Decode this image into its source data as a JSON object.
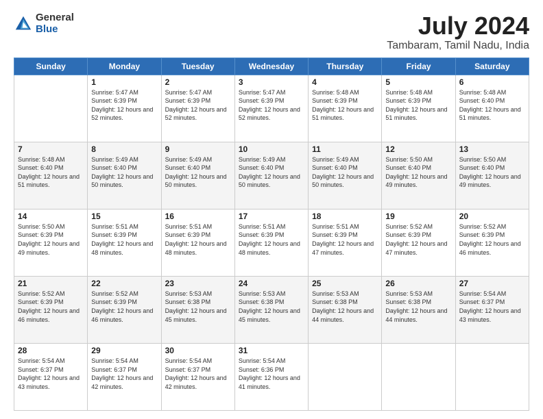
{
  "logo": {
    "general": "General",
    "blue": "Blue"
  },
  "title": "July 2024",
  "subtitle": "Tambaram, Tamil Nadu, India",
  "columns": [
    "Sunday",
    "Monday",
    "Tuesday",
    "Wednesday",
    "Thursday",
    "Friday",
    "Saturday"
  ],
  "weeks": [
    [
      {
        "day": "",
        "sunrise": "",
        "sunset": "",
        "daylight": ""
      },
      {
        "day": "1",
        "sunrise": "Sunrise: 5:47 AM",
        "sunset": "Sunset: 6:39 PM",
        "daylight": "Daylight: 12 hours and 52 minutes."
      },
      {
        "day": "2",
        "sunrise": "Sunrise: 5:47 AM",
        "sunset": "Sunset: 6:39 PM",
        "daylight": "Daylight: 12 hours and 52 minutes."
      },
      {
        "day": "3",
        "sunrise": "Sunrise: 5:47 AM",
        "sunset": "Sunset: 6:39 PM",
        "daylight": "Daylight: 12 hours and 52 minutes."
      },
      {
        "day": "4",
        "sunrise": "Sunrise: 5:48 AM",
        "sunset": "Sunset: 6:39 PM",
        "daylight": "Daylight: 12 hours and 51 minutes."
      },
      {
        "day": "5",
        "sunrise": "Sunrise: 5:48 AM",
        "sunset": "Sunset: 6:39 PM",
        "daylight": "Daylight: 12 hours and 51 minutes."
      },
      {
        "day": "6",
        "sunrise": "Sunrise: 5:48 AM",
        "sunset": "Sunset: 6:40 PM",
        "daylight": "Daylight: 12 hours and 51 minutes."
      }
    ],
    [
      {
        "day": "7",
        "sunrise": "Sunrise: 5:48 AM",
        "sunset": "Sunset: 6:40 PM",
        "daylight": "Daylight: 12 hours and 51 minutes."
      },
      {
        "day": "8",
        "sunrise": "Sunrise: 5:49 AM",
        "sunset": "Sunset: 6:40 PM",
        "daylight": "Daylight: 12 hours and 50 minutes."
      },
      {
        "day": "9",
        "sunrise": "Sunrise: 5:49 AM",
        "sunset": "Sunset: 6:40 PM",
        "daylight": "Daylight: 12 hours and 50 minutes."
      },
      {
        "day": "10",
        "sunrise": "Sunrise: 5:49 AM",
        "sunset": "Sunset: 6:40 PM",
        "daylight": "Daylight: 12 hours and 50 minutes."
      },
      {
        "day": "11",
        "sunrise": "Sunrise: 5:49 AM",
        "sunset": "Sunset: 6:40 PM",
        "daylight": "Daylight: 12 hours and 50 minutes."
      },
      {
        "day": "12",
        "sunrise": "Sunrise: 5:50 AM",
        "sunset": "Sunset: 6:40 PM",
        "daylight": "Daylight: 12 hours and 49 minutes."
      },
      {
        "day": "13",
        "sunrise": "Sunrise: 5:50 AM",
        "sunset": "Sunset: 6:40 PM",
        "daylight": "Daylight: 12 hours and 49 minutes."
      }
    ],
    [
      {
        "day": "14",
        "sunrise": "Sunrise: 5:50 AM",
        "sunset": "Sunset: 6:39 PM",
        "daylight": "Daylight: 12 hours and 49 minutes."
      },
      {
        "day": "15",
        "sunrise": "Sunrise: 5:51 AM",
        "sunset": "Sunset: 6:39 PM",
        "daylight": "Daylight: 12 hours and 48 minutes."
      },
      {
        "day": "16",
        "sunrise": "Sunrise: 5:51 AM",
        "sunset": "Sunset: 6:39 PM",
        "daylight": "Daylight: 12 hours and 48 minutes."
      },
      {
        "day": "17",
        "sunrise": "Sunrise: 5:51 AM",
        "sunset": "Sunset: 6:39 PM",
        "daylight": "Daylight: 12 hours and 48 minutes."
      },
      {
        "day": "18",
        "sunrise": "Sunrise: 5:51 AM",
        "sunset": "Sunset: 6:39 PM",
        "daylight": "Daylight: 12 hours and 47 minutes."
      },
      {
        "day": "19",
        "sunrise": "Sunrise: 5:52 AM",
        "sunset": "Sunset: 6:39 PM",
        "daylight": "Daylight: 12 hours and 47 minutes."
      },
      {
        "day": "20",
        "sunrise": "Sunrise: 5:52 AM",
        "sunset": "Sunset: 6:39 PM",
        "daylight": "Daylight: 12 hours and 46 minutes."
      }
    ],
    [
      {
        "day": "21",
        "sunrise": "Sunrise: 5:52 AM",
        "sunset": "Sunset: 6:39 PM",
        "daylight": "Daylight: 12 hours and 46 minutes."
      },
      {
        "day": "22",
        "sunrise": "Sunrise: 5:52 AM",
        "sunset": "Sunset: 6:39 PM",
        "daylight": "Daylight: 12 hours and 46 minutes."
      },
      {
        "day": "23",
        "sunrise": "Sunrise: 5:53 AM",
        "sunset": "Sunset: 6:38 PM",
        "daylight": "Daylight: 12 hours and 45 minutes."
      },
      {
        "day": "24",
        "sunrise": "Sunrise: 5:53 AM",
        "sunset": "Sunset: 6:38 PM",
        "daylight": "Daylight: 12 hours and 45 minutes."
      },
      {
        "day": "25",
        "sunrise": "Sunrise: 5:53 AM",
        "sunset": "Sunset: 6:38 PM",
        "daylight": "Daylight: 12 hours and 44 minutes."
      },
      {
        "day": "26",
        "sunrise": "Sunrise: 5:53 AM",
        "sunset": "Sunset: 6:38 PM",
        "daylight": "Daylight: 12 hours and 44 minutes."
      },
      {
        "day": "27",
        "sunrise": "Sunrise: 5:54 AM",
        "sunset": "Sunset: 6:37 PM",
        "daylight": "Daylight: 12 hours and 43 minutes."
      }
    ],
    [
      {
        "day": "28",
        "sunrise": "Sunrise: 5:54 AM",
        "sunset": "Sunset: 6:37 PM",
        "daylight": "Daylight: 12 hours and 43 minutes."
      },
      {
        "day": "29",
        "sunrise": "Sunrise: 5:54 AM",
        "sunset": "Sunset: 6:37 PM",
        "daylight": "Daylight: 12 hours and 42 minutes."
      },
      {
        "day": "30",
        "sunrise": "Sunrise: 5:54 AM",
        "sunset": "Sunset: 6:37 PM",
        "daylight": "Daylight: 12 hours and 42 minutes."
      },
      {
        "day": "31",
        "sunrise": "Sunrise: 5:54 AM",
        "sunset": "Sunset: 6:36 PM",
        "daylight": "Daylight: 12 hours and 41 minutes."
      },
      {
        "day": "",
        "sunrise": "",
        "sunset": "",
        "daylight": ""
      },
      {
        "day": "",
        "sunrise": "",
        "sunset": "",
        "daylight": ""
      },
      {
        "day": "",
        "sunrise": "",
        "sunset": "",
        "daylight": ""
      }
    ]
  ]
}
